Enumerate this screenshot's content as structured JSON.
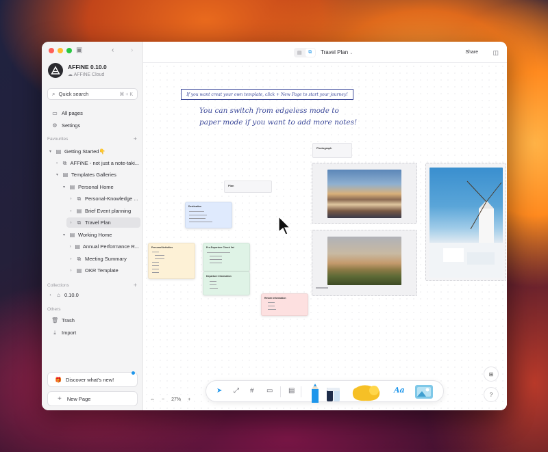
{
  "window": {
    "workspace_name": "AFFiNE 0.10.0",
    "workspace_sub": "AFFiNE Cloud"
  },
  "sidebar": {
    "search_label": "Quick search",
    "search_shortcut": "⌘ + K",
    "nav": {
      "all_pages": "All pages",
      "settings": "Settings"
    },
    "favourites_label": "Favourites",
    "tree": [
      {
        "label": "Getting Started👇"
      },
      {
        "label": "AFFiNE - not just a note-taki..."
      },
      {
        "label": "Templates Galleries"
      },
      {
        "label": "Personal Home"
      },
      {
        "label": "Personal-Knowledge ..."
      },
      {
        "label": "Brief Event planning"
      },
      {
        "label": "Travel Plan"
      },
      {
        "label": "Working Home"
      },
      {
        "label": "Annual Performance R..."
      },
      {
        "label": "Meeting Summary"
      },
      {
        "label": "OKR Template"
      }
    ],
    "collections_label": "Collections",
    "collection_item": "0.10.0",
    "others_label": "Others",
    "trash": "Trash",
    "import": "Import",
    "discover": "Discover what's new!",
    "new_page": "New Page"
  },
  "topbar": {
    "title": "Travel Plan",
    "share": "Share"
  },
  "canvas": {
    "tip": "If you want creat your own template, click + New Page to start your journey!",
    "hand_text_line1": "You can switch from edgeless mode to",
    "hand_text_line2": "paper mode if you want to add more notes!",
    "photograph_label": "Photograph",
    "plan_label": "Plan",
    "cards": {
      "destination": "Destination",
      "personal_activities": "Personal Activities",
      "pre_departure": "Pre-Departure Check list",
      "departure_information": "Departure Information",
      "return_information": "Return Information"
    }
  },
  "bottom": {
    "zoom": "27%"
  },
  "colors": {
    "accent": "#1e96eb",
    "handwriting": "#3d4a9a",
    "note_blue": "#dfeafd",
    "note_yellow": "#fdf1d6",
    "note_green": "#dff3e6",
    "note_red": "#fde0e0"
  }
}
